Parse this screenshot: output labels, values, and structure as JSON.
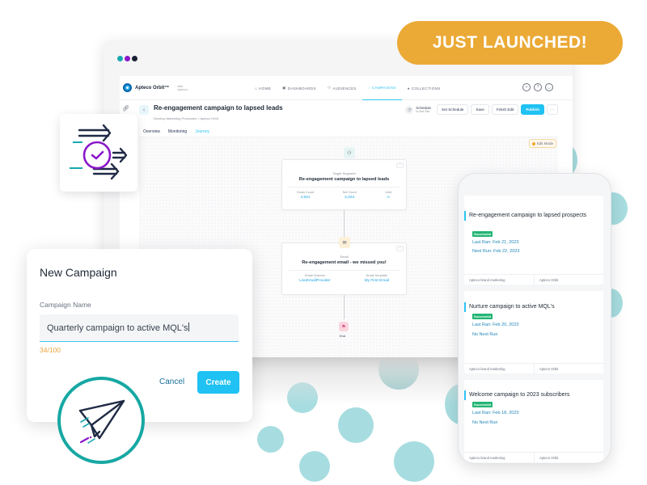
{
  "badge": {
    "text": "JUST LAUNCHED!",
    "color": "#ebaa36"
  },
  "browser": {
    "dots": [
      "#17a8b0",
      "#8a18c9",
      "#1b2033"
    ]
  },
  "app": {
    "logo": {
      "name": "Apteco Orbit™",
      "with_label": "with",
      "with_brand": "Apteco"
    },
    "nav": [
      {
        "icon": "home-icon",
        "glyph": "⌂",
        "label": "HOME",
        "active": false
      },
      {
        "icon": "dashboards-icon",
        "glyph": "▣",
        "label": "DASHBOARDS",
        "active": false
      },
      {
        "icon": "audiences-icon",
        "glyph": "⚇",
        "label": "AUDIENCES",
        "active": false
      },
      {
        "icon": "campaigns-icon",
        "glyph": "◌",
        "label": "CAMPAIGNS",
        "active": true
      },
      {
        "icon": "collections-icon",
        "glyph": "●",
        "label": "COLLECTIONS",
        "active": false
      }
    ],
    "nav_icons": [
      {
        "name": "add-circle-icon",
        "glyph": "+"
      },
      {
        "name": "help-icon",
        "glyph": "?"
      },
      {
        "name": "user-account-icon",
        "glyph": "◡"
      }
    ],
    "page_title": "Re-engagement campaign to lapsed leads",
    "breadcrumb": "Develop Marketing Processes  >  Apteco Orbit",
    "schedule": {
      "title": "Schedule",
      "subtitle": "Is Not Set"
    },
    "buttons": {
      "set_schedule": "Set Schedule",
      "save": "Save",
      "finish_edit": "Finish Edit",
      "publish": "Publish",
      "more": "···"
    },
    "tabs": [
      {
        "label": "Overview",
        "active": false
      },
      {
        "label": "Monitoring",
        "active": false
      },
      {
        "label": "Journey",
        "active": true
      }
    ],
    "edit_mode": "Edit Mode",
    "journey": {
      "segment": {
        "kind": "Target Segment",
        "title": "Re-engagement campaign to lapsed leads",
        "stats": [
          {
            "label": "Gross Count",
            "value": "4,921"
          },
          {
            "label": "Net Count",
            "value": "2,023"
          },
          {
            "label": "Limit",
            "value": "∞"
          }
        ]
      },
      "email": {
        "kind": "Email",
        "title": "Re-engagement email - we missed you!",
        "stats": [
          {
            "label": "Email Channel",
            "value": "LiveEmailProvider"
          },
          {
            "label": "Email Template",
            "value": "My First Email"
          }
        ]
      },
      "end": {
        "label": "End"
      }
    }
  },
  "dialog": {
    "title": "New Campaign",
    "field_label": "Campaign Name",
    "field_value": "Quarterly campaign to active MQL's",
    "counter": "34/100",
    "cancel": "Cancel",
    "create": "Create"
  },
  "phone": {
    "campaigns": [
      {
        "title": "Re-engagement campaign to lapsed prospects",
        "status": "Successful",
        "last_run": "Last Ran: Feb 21, 2023",
        "next_run": "Next Run: Feb 22, 2023",
        "footer": [
          "Apteco brand marketing",
          "Apteco Orbit"
        ]
      },
      {
        "title": "Nurture campaign to active MQL's",
        "status": "Successful",
        "last_run": "Last Ran: Feb 20, 2023",
        "next_run": "No Next Run",
        "footer": [
          "Apteco brand marketing",
          "Apteco Orbit"
        ]
      },
      {
        "title": "Welcome campaign to 2023 subscribers",
        "status": "Successful",
        "last_run": "Last Ran: Feb 18, 2023",
        "next_run": "No Next Run",
        "footer": [
          "Apteco brand marketing",
          "Apteco Orbit"
        ]
      }
    ]
  }
}
